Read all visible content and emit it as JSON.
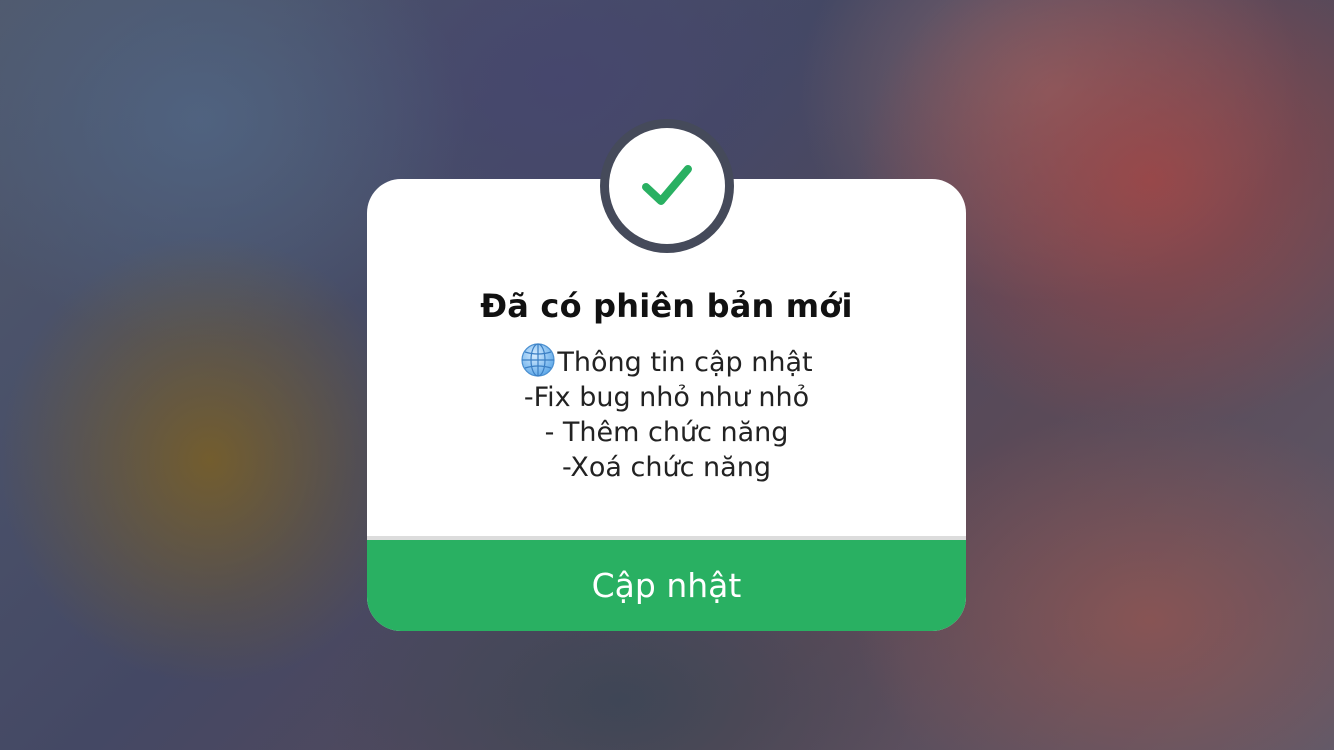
{
  "dialog": {
    "title": "Đã có phiên bản mới",
    "status_icon": "checkmark-icon",
    "message_icon": "globe-icon",
    "message_lines": [
      "Thông tin cập nhật",
      "-Fix bug nhỏ như nhỏ",
      "- Thêm chức năng",
      "-Xoá chức năng"
    ],
    "button_label": "Cập nhật"
  },
  "colors": {
    "accent_green": "#29b062",
    "badge_ring": "#454a5a",
    "card": "#ffffff"
  }
}
